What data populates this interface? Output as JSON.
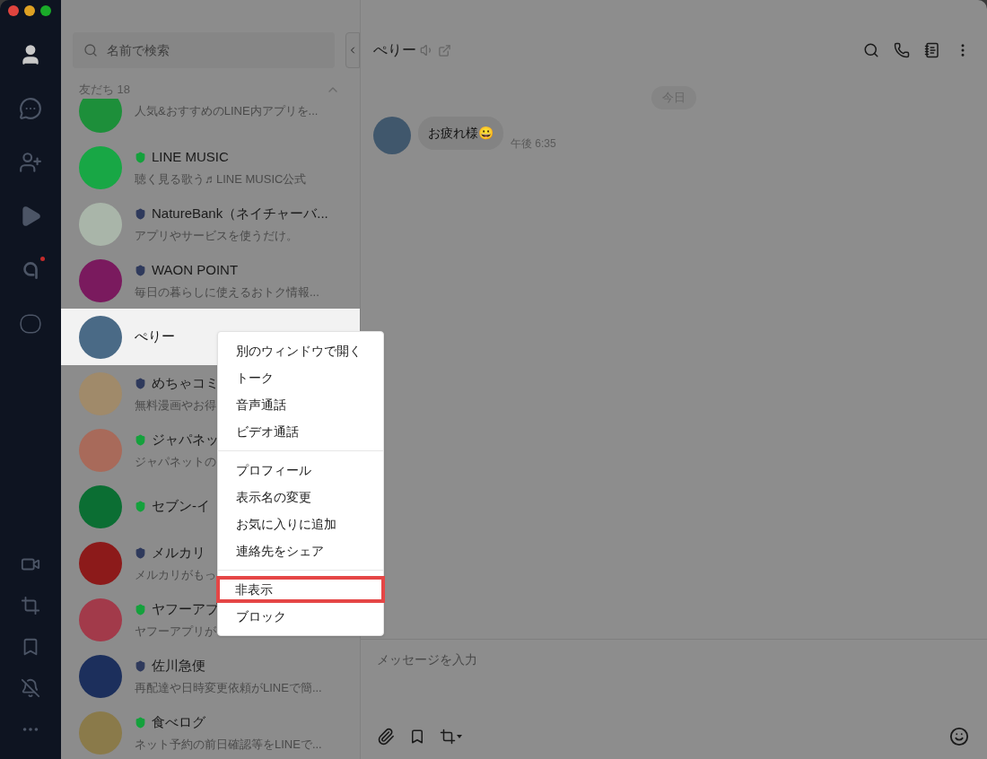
{
  "window": {
    "controls": [
      {
        "color": "#e0443e"
      },
      {
        "color": "#dea123"
      },
      {
        "color": "#1aab29"
      }
    ]
  },
  "sidebar": {
    "items": [
      {
        "kind": "friends",
        "selected": true
      },
      {
        "kind": "chats",
        "selected": false
      },
      {
        "kind": "add-friend",
        "selected": false
      },
      {
        "kind": "voom",
        "selected": false
      },
      {
        "kind": "news",
        "selected": false,
        "badge": true
      },
      {
        "kind": "line",
        "selected": false
      }
    ],
    "bottom_items": [
      {
        "kind": "video-add"
      },
      {
        "kind": "crop"
      },
      {
        "kind": "bookmark"
      },
      {
        "kind": "notify-off"
      },
      {
        "kind": "more"
      }
    ]
  },
  "search": {
    "placeholder": "名前で検索"
  },
  "section": {
    "title": "友だち 18",
    "expanded": true
  },
  "contacts": [
    {
      "subtitle": "人気&おすすめのLINE内アプリを...",
      "color": "#1d8f3a",
      "selected": false
    },
    {
      "name": "LINE MUSIC",
      "subtitle": "聴く見る歌う♬LINE MUSIC公式",
      "badge": {
        "color": "#14a13c"
      },
      "color": "#18a745",
      "selected": false
    },
    {
      "name": "NatureBank（ネイチャーバ...",
      "subtitle": "アプリやサービスを使うだけ。",
      "badge": {
        "color": "#2f3a5c"
      },
      "color": "#a9b5a9",
      "selected": false
    },
    {
      "name": "WAON POINT",
      "subtitle": "毎日の暮らしに使えるおトク情報...",
      "badge": {
        "color": "#2f3a5c"
      },
      "color": "#7a1a5e",
      "selected": false
    },
    {
      "name": "ぺりー",
      "color": "#4a6a86",
      "selected": true
    },
    {
      "name": "めちゃコミ",
      "subtitle": "無料漫画やお得",
      "badge": {
        "color": "#2f3a5c"
      },
      "color": "#a08a6a",
      "selected": false
    },
    {
      "name": "ジャパネッ",
      "subtitle": "ジャパネットの",
      "badge": {
        "color": "#14a13c"
      },
      "color": "#a86a5a",
      "selected": false
    },
    {
      "name": "セブン-イ",
      "badge": {
        "color": "#14a13c"
      },
      "color": "#0b6e33",
      "selected": false
    },
    {
      "name": "メルカリ",
      "subtitle": "メルカリがもっ",
      "badge": {
        "color": "#2f3a5c"
      },
      "color": "#8c1a1a",
      "selected": false
    },
    {
      "name": "ヤフーアプ",
      "subtitle": "ヤフーアプリが",
      "badge": {
        "color": "#14a13c"
      },
      "color": "#a23a4a",
      "selected": false
    },
    {
      "name": "佐川急便",
      "subtitle": "再配達や日時変更依頼がLINEで簡...",
      "badge": {
        "color": "#2f3a5c"
      },
      "color": "#1c2f5c",
      "selected": false
    },
    {
      "name": "食べログ",
      "subtitle": "ネット予約の前日確認等をLINEで...",
      "badge": {
        "color": "#14a13c"
      },
      "color": "#8a7a4a",
      "selected": false
    }
  ],
  "chat": {
    "title": "ぺりー",
    "date": "今日",
    "messages": [
      {
        "text": "お疲れ様😀",
        "time": "午後 6:35"
      }
    ],
    "input": {
      "placeholder": "メッセージを入力"
    }
  },
  "context_menu": {
    "groups": [
      [
        {
          "label": "別のウィンドウで開く",
          "highlighted": false
        },
        {
          "label": "トーク",
          "highlighted": false
        },
        {
          "label": "音声通話",
          "highlighted": false
        },
        {
          "label": "ビデオ通話",
          "highlighted": false
        }
      ],
      [
        {
          "label": "プロフィール",
          "highlighted": false
        },
        {
          "label": "表示名の変更",
          "highlighted": false
        },
        {
          "label": "お気に入りに追加",
          "highlighted": false
        },
        {
          "label": "連絡先をシェア",
          "highlighted": false
        }
      ],
      [
        {
          "label": "非表示",
          "highlighted": true
        },
        {
          "label": "ブロック",
          "highlighted": false
        }
      ]
    ]
  }
}
